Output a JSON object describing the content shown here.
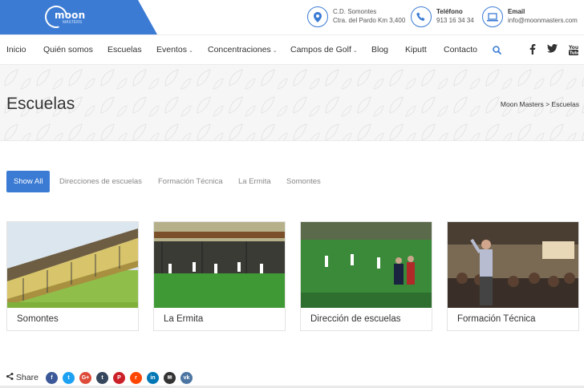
{
  "brand": {
    "logo_text": "moon",
    "logo_sub": "MASTERS",
    "color": "#3b7bd4"
  },
  "header": {
    "address": {
      "line1": "C.D. Somontes",
      "line2": "Ctra. del Pardo Km 3,400",
      "icon": "map-pin-icon"
    },
    "phone": {
      "label": "Teléfono",
      "value": "913 16 34 34",
      "icon": "phone-icon"
    },
    "email": {
      "label": "Email",
      "value": "info@moonmasters.com",
      "icon": "laptop-icon"
    }
  },
  "nav": {
    "items": [
      {
        "label": "Inicio"
      },
      {
        "label": "Quién somos"
      },
      {
        "label": "Escuelas"
      },
      {
        "label": "Eventos",
        "dropdown": true
      },
      {
        "label": "Concentraciones",
        "dropdown": true
      },
      {
        "label": "Campos de Golf",
        "dropdown": true
      },
      {
        "label": "Blog"
      },
      {
        "label": "Kiputt"
      },
      {
        "label": "Contacto"
      }
    ],
    "caret": "⌄",
    "social": [
      "facebook-icon",
      "twitter-icon",
      "youtube-icon"
    ]
  },
  "page": {
    "title": "Escuelas",
    "breadcrumb": {
      "home": "Moon Masters",
      "sep": ">",
      "current": "Escuelas"
    }
  },
  "filters": [
    "Show All",
    "Direcciones de escuelas",
    "Formación Técnica",
    "La Ermita",
    "Somontes"
  ],
  "cards": [
    {
      "caption": "Somontes"
    },
    {
      "caption": "La Ermita"
    },
    {
      "caption": "Dirección de escuelas"
    },
    {
      "caption": "Formación Técnica"
    }
  ],
  "share": {
    "label": "Share",
    "buttons": [
      {
        "name": "facebook-share-icon",
        "glyph": "f",
        "color": "#3b5998"
      },
      {
        "name": "twitter-share-icon",
        "glyph": "t",
        "color": "#1da1f2"
      },
      {
        "name": "googleplus-share-icon",
        "glyph": "G+",
        "color": "#dd4b39"
      },
      {
        "name": "tumblr-share-icon",
        "glyph": "t",
        "color": "#35465c"
      },
      {
        "name": "pinterest-share-icon",
        "glyph": "P",
        "color": "#cb2027"
      },
      {
        "name": "reddit-share-icon",
        "glyph": "r",
        "color": "#ff4500"
      },
      {
        "name": "linkedin-share-icon",
        "glyph": "in",
        "color": "#0077b5"
      },
      {
        "name": "email-share-icon",
        "glyph": "✉",
        "color": "#333333"
      },
      {
        "name": "vk-share-icon",
        "glyph": "vk",
        "color": "#4c75a3"
      }
    ]
  }
}
